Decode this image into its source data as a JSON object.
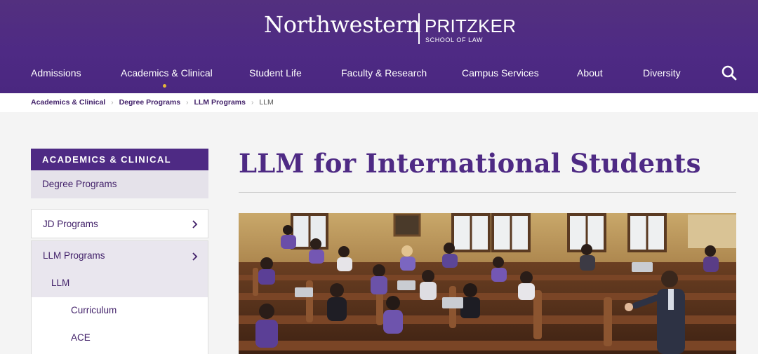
{
  "header": {
    "logo_main": "Northwestern",
    "logo_brand": "PRITZKER",
    "logo_school": "SCHOOL OF LAW",
    "nav": [
      {
        "label": "Admissions"
      },
      {
        "label": "Academics & Clinical"
      },
      {
        "label": "Student Life"
      },
      {
        "label": "Faculty & Research"
      },
      {
        "label": "Campus Services"
      },
      {
        "label": "About"
      },
      {
        "label": "Diversity"
      }
    ],
    "search_icon": "search-icon"
  },
  "breadcrumb": [
    "Academics & Clinical",
    "Degree Programs",
    "LLM Programs",
    "LLM"
  ],
  "sidebar": {
    "heading": "ACADEMICS & CLINICAL",
    "parent": "Degree Programs",
    "items": [
      {
        "label": "JD Programs",
        "icon": "chevron-right-icon"
      },
      {
        "label": "LLM Programs",
        "icon": "chevron-right-icon"
      }
    ],
    "active": "LLM",
    "children": [
      "Curriculum",
      "ACE"
    ]
  },
  "main": {
    "title": "LLM for International Students"
  },
  "colors": {
    "purple": "#4e2a84",
    "accent_gold": "#e4b63a",
    "sidebar_active_bg": "#e9e6ee"
  }
}
